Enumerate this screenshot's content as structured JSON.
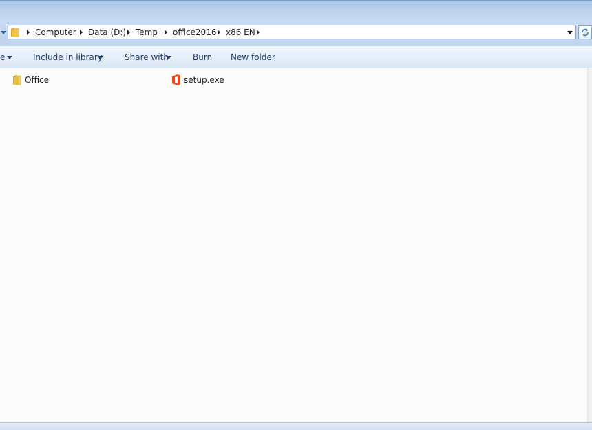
{
  "address_bar": {
    "crumbs": [
      "Computer",
      "Data (D:)",
      "Temp",
      "office2016",
      "x86 EN"
    ]
  },
  "toolbar": {
    "organize_partial": "e",
    "include_in_library": "Include in library",
    "share_with": "Share with",
    "burn": "Burn",
    "new_folder": "New folder"
  },
  "files": [
    {
      "name": "Office",
      "icon": "folder-icon"
    },
    {
      "name": "setup.exe",
      "icon": "office-setup-icon"
    }
  ],
  "colors": {
    "office_orange": "#e8491b",
    "folder_yellow": "#e9c04a"
  }
}
